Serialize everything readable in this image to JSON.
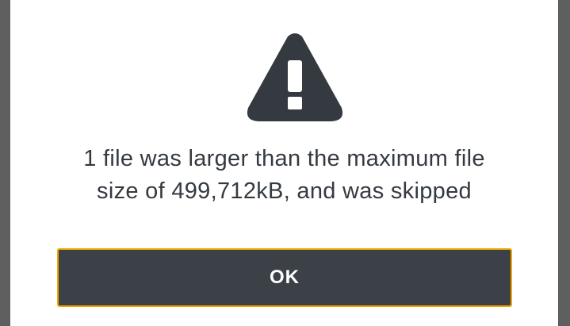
{
  "dialog": {
    "icon": "warning-triangle-icon",
    "message_line1": "1 file was larger than the maximum file",
    "message_line2": "size of 499,712kB, and was skipped",
    "ok_label": "OK"
  },
  "colors": {
    "icon": "#343a40",
    "text": "#343a40",
    "button_bg": "#3c4148",
    "button_focus_border": "#f0a500",
    "button_text": "#ffffff",
    "overlay": "#5f5f5f"
  }
}
